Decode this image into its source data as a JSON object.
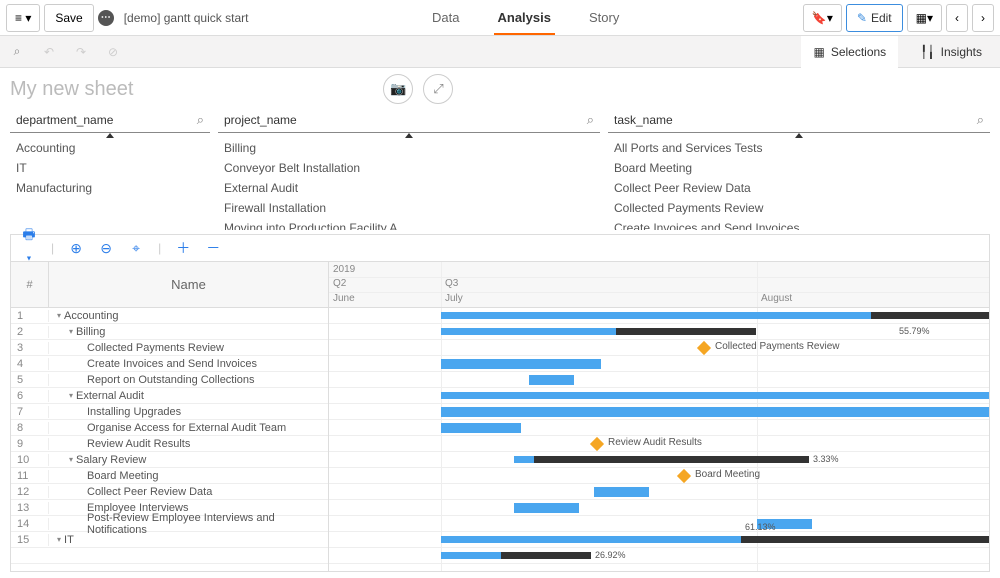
{
  "toolbar": {
    "save": "Save",
    "app_title": "[demo] gantt quick start",
    "tabs": {
      "data": "Data",
      "analysis": "Analysis",
      "story": "Story"
    },
    "edit": "Edit"
  },
  "subbar": {
    "selections": "Selections",
    "insights": "Insights"
  },
  "sheet": {
    "title": "My new sheet"
  },
  "filters": {
    "department": {
      "label": "department_name",
      "items": [
        "Accounting",
        "IT",
        "Manufacturing"
      ]
    },
    "project": {
      "label": "project_name",
      "items": [
        "Billing",
        "Conveyor Belt Installation",
        "External Audit",
        "Firewall Installation",
        "Moving into Production Facility A"
      ]
    },
    "task": {
      "label": "task_name",
      "items": [
        "All Ports and Services Tests",
        "Board Meeting",
        "Collect Peer Review Data",
        "Collected Payments Review",
        "Create Invoices and Send Invoices"
      ]
    }
  },
  "gantt": {
    "numcol": "#",
    "namecol": "Name",
    "year": "2019",
    "q2": "Q2",
    "q3": "Q3",
    "months": {
      "jun": "June",
      "jul": "July",
      "aug": "August"
    },
    "rows": [
      {
        "n": "1",
        "name": "Accounting",
        "level": 0
      },
      {
        "n": "2",
        "name": "Billing",
        "level": 1
      },
      {
        "n": "3",
        "name": "Collected Payments Review",
        "level": 2
      },
      {
        "n": "4",
        "name": "Create Invoices and Send Invoices",
        "level": 2
      },
      {
        "n": "5",
        "name": "Report on Outstanding Collections",
        "level": 2
      },
      {
        "n": "6",
        "name": "External Audit",
        "level": 1
      },
      {
        "n": "7",
        "name": "Installing Upgrades",
        "level": 2
      },
      {
        "n": "8",
        "name": "Organise Access for External Audit Team",
        "level": 2
      },
      {
        "n": "9",
        "name": "Review Audit Results",
        "level": 2
      },
      {
        "n": "10",
        "name": "Salary Review",
        "level": 1
      },
      {
        "n": "11",
        "name": "Board Meeting",
        "level": 2
      },
      {
        "n": "12",
        "name": "Collect Peer Review Data",
        "level": 2
      },
      {
        "n": "13",
        "name": "Employee Interviews",
        "level": 2
      },
      {
        "n": "14",
        "name": "Post-Review Employee Interviews and Notifications",
        "level": 2
      },
      {
        "n": "15",
        "name": "IT",
        "level": 0
      },
      {
        "n": "",
        "name": "",
        "level": 1
      }
    ],
    "labels": {
      "p1": "55.79%",
      "p2": "3.33%",
      "p3": "61.13%",
      "p4": "26.92%",
      "m1": "Collected Payments Review",
      "m2": "Review Audit Results",
      "m3": "Board Meeting"
    }
  },
  "chart_data": {
    "type": "gantt",
    "time_axis": {
      "year": 2019,
      "quarters": [
        "Q2",
        "Q3"
      ],
      "months": [
        "June",
        "July",
        "August"
      ],
      "range_start": "2019-06-01",
      "range_end": "2019-08-31"
    },
    "rows": [
      {
        "id": 1,
        "name": "Accounting",
        "type": "summary",
        "start": "2019-07-01",
        "end": "2019-08-31",
        "progress_split": "2019-08-10"
      },
      {
        "id": 2,
        "name": "Billing",
        "type": "summary",
        "start": "2019-07-01",
        "end": "2019-07-31",
        "progress_pct": 55.79
      },
      {
        "id": 3,
        "name": "Collected Payments Review",
        "type": "milestone",
        "date": "2019-07-31"
      },
      {
        "id": 4,
        "name": "Create Invoices and Send Invoices",
        "type": "task",
        "start": "2019-07-01",
        "end": "2019-07-17"
      },
      {
        "id": 5,
        "name": "Report on Outstanding Collections",
        "type": "task",
        "start": "2019-07-10",
        "end": "2019-07-17"
      },
      {
        "id": 6,
        "name": "External Audit",
        "type": "summary",
        "start": "2019-07-01",
        "end": "2019-08-31"
      },
      {
        "id": 7,
        "name": "Installing Upgrades",
        "type": "task",
        "start": "2019-07-01",
        "end": "2019-08-31"
      },
      {
        "id": 8,
        "name": "Organise Access for External Audit Team",
        "type": "task",
        "start": "2019-07-01",
        "end": "2019-07-10"
      },
      {
        "id": 9,
        "name": "Review Audit Results",
        "type": "milestone",
        "date": "2019-07-24"
      },
      {
        "id": 10,
        "name": "Salary Review",
        "type": "summary",
        "start": "2019-07-07",
        "end": "2019-08-15",
        "progress_pct": 3.33
      },
      {
        "id": 11,
        "name": "Board Meeting",
        "type": "milestone",
        "date": "2019-07-30"
      },
      {
        "id": 12,
        "name": "Collect Peer Review Data",
        "type": "task",
        "start": "2019-07-21",
        "end": "2019-07-28"
      },
      {
        "id": 13,
        "name": "Employee Interviews",
        "type": "task",
        "start": "2019-07-07",
        "end": "2019-07-14"
      },
      {
        "id": 14,
        "name": "Post-Review Employee Interviews and Notifications",
        "type": "task",
        "start": "2019-08-01",
        "end": "2019-08-09"
      },
      {
        "id": 15,
        "name": "IT",
        "type": "summary",
        "start": "2019-07-01",
        "end": "2019-08-31",
        "progress_pct": 61.13
      }
    ]
  }
}
